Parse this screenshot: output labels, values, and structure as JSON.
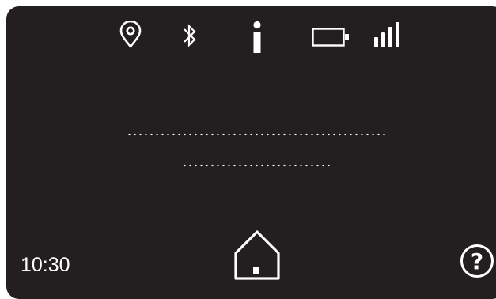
{
  "status_bar": {
    "icons": [
      "location-pin-icon",
      "bluetooth-icon",
      "info-icon",
      "battery-icon",
      "signal-strength-icon"
    ]
  },
  "footer": {
    "time": "10:30",
    "home_icon": "home-icon",
    "help_symbol": "?"
  },
  "colors": {
    "screen_background": "#231f20",
    "foreground": "#ffffff",
    "page_background": "#ffffff"
  }
}
